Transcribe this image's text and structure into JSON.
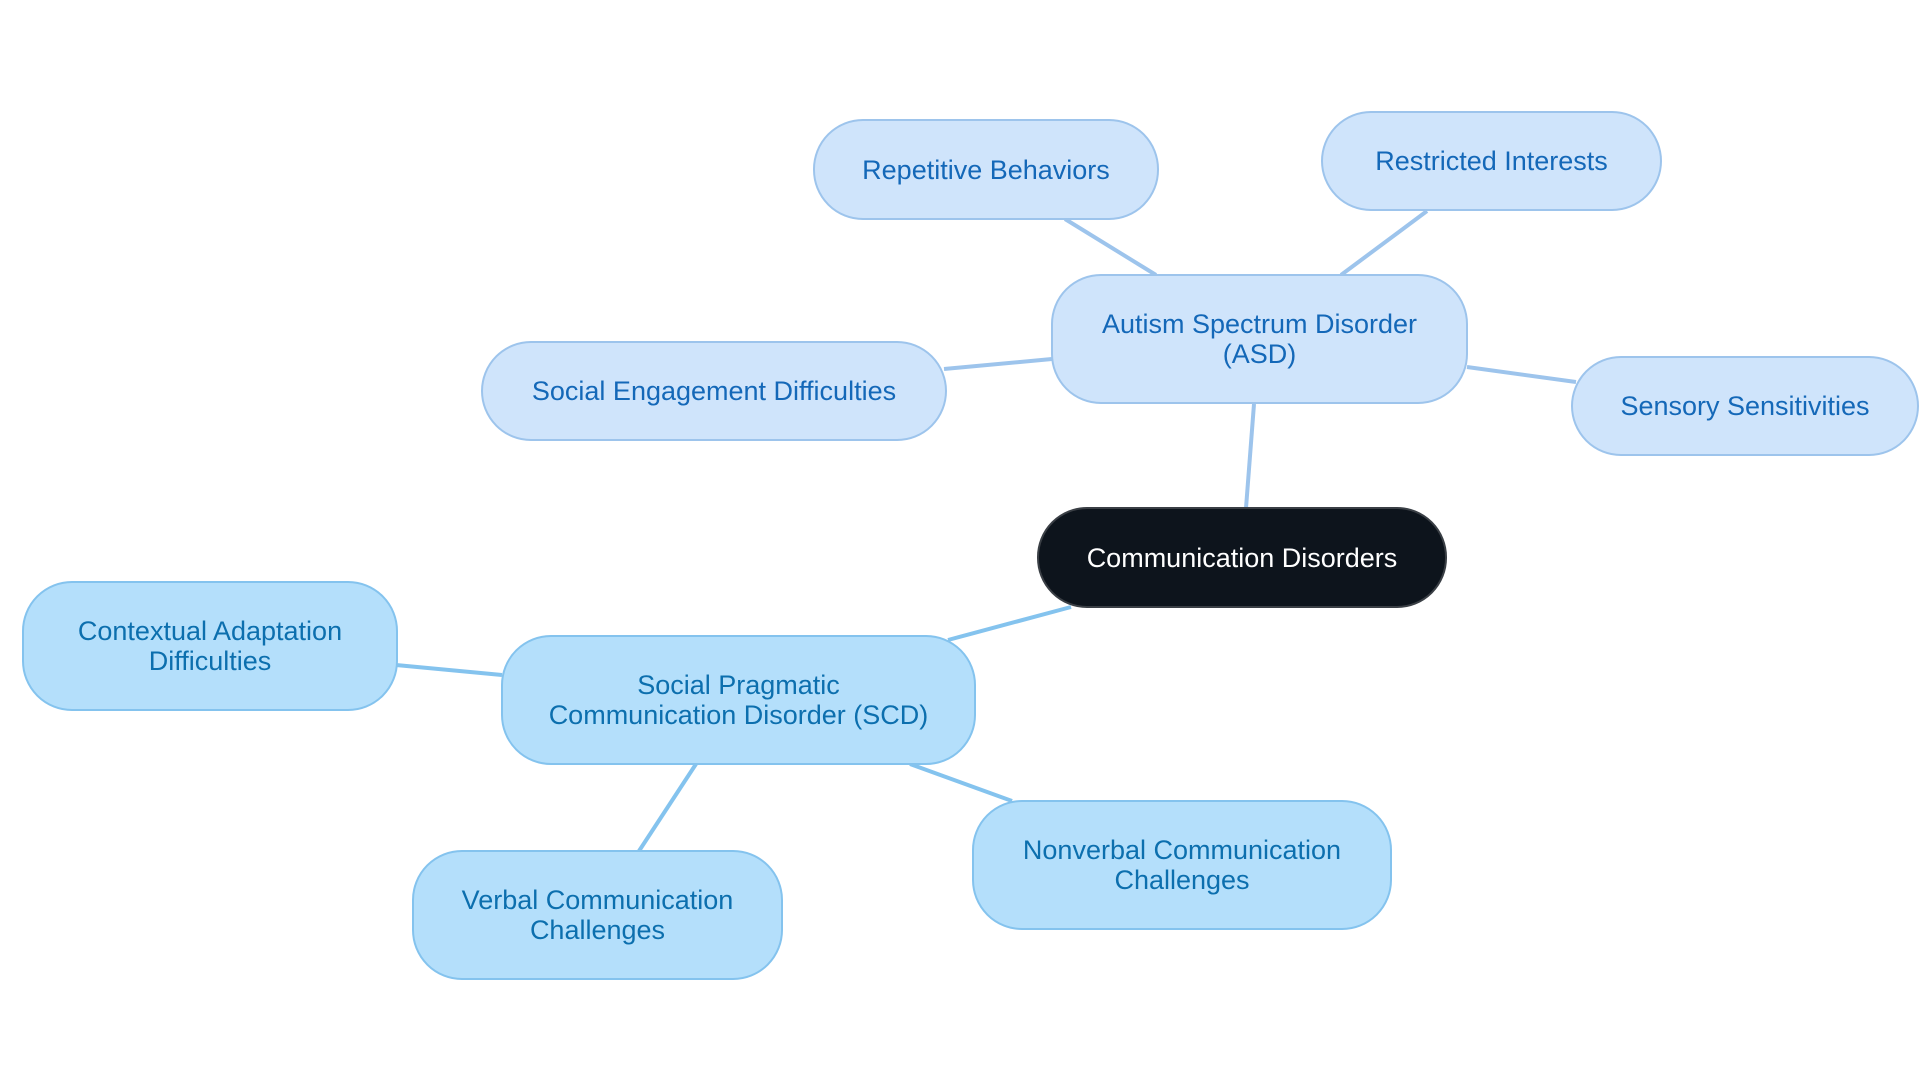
{
  "diagram": {
    "type": "mind-map",
    "root": {
      "id": "root",
      "label": "Communication Disorders"
    },
    "nodes": [
      {
        "id": "asd",
        "label": "Autism Spectrum Disorder\n(ASD)",
        "parent": "root"
      },
      {
        "id": "repetitive",
        "label": "Repetitive Behaviors",
        "parent": "asd"
      },
      {
        "id": "restricted",
        "label": "Restricted Interests",
        "parent": "asd"
      },
      {
        "id": "sensory",
        "label": "Sensory Sensitivities",
        "parent": "asd"
      },
      {
        "id": "social-engagement",
        "label": "Social Engagement Difficulties",
        "parent": "asd"
      },
      {
        "id": "scd",
        "label": "Social Pragmatic\nCommunication Disorder (SCD)",
        "parent": "root"
      },
      {
        "id": "contextual",
        "label": "Contextual Adaptation\nDifficulties",
        "parent": "scd"
      },
      {
        "id": "verbal",
        "label": "Verbal Communication\nChallenges",
        "parent": "scd"
      },
      {
        "id": "nonverbal",
        "label": "Nonverbal Communication\nChallenges",
        "parent": "scd"
      }
    ],
    "colors": {
      "root_fill": "#0d141c",
      "root_text": "#ffffff",
      "asd_branch_fill": "#cfe4fb",
      "asd_branch_text": "#1468b8",
      "asd_branch_edge": "#9dc4ec",
      "scd_branch_fill": "#b4dffb",
      "scd_branch_text": "#0c6fae",
      "scd_branch_edge": "#84c3ee"
    }
  }
}
